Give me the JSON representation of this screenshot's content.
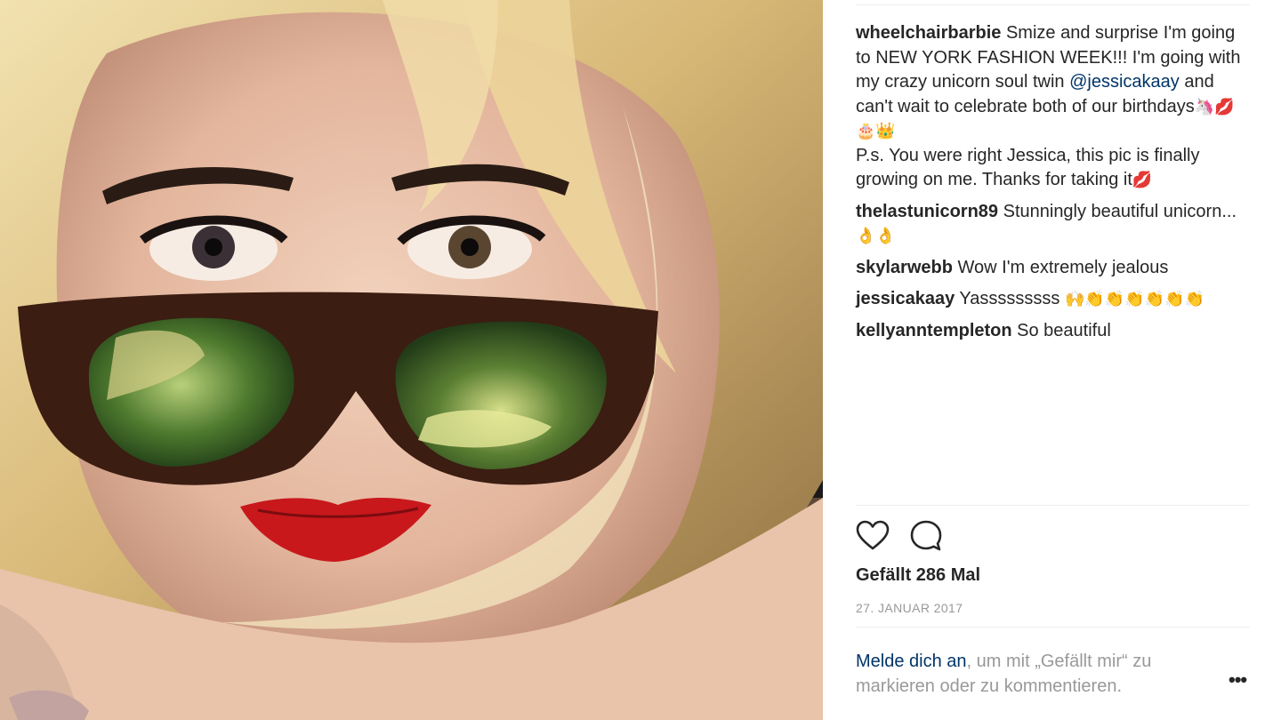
{
  "post": {
    "image_alt": "Photo of a woman with blonde hair, red lipstick and mirrored sunglasses",
    "colors": {
      "username": "#262626",
      "link": "#003569",
      "muted": "#999999"
    }
  },
  "comments": [
    {
      "user": "wheelchairbarbie",
      "line1_pre": " Smize and surprise I'm going to NEW YORK FASHION WEEK!!! I'm going with my crazy unicorn soul twin ",
      "mention": "@jessicakaay",
      "line1_post": " and can't wait to celebrate both of our birthdays",
      "line1_emoji": "🦄💋🎂👑",
      "line2": "P.s. You were right Jessica, this pic is finally growing on me. Thanks for taking it",
      "line2_emoji": "💋"
    },
    {
      "user": "thelastunicorn89",
      "text": " Stunningly beautiful unicorn...",
      "emoji": "👌👌"
    },
    {
      "user": "skylarwebb",
      "text": " Wow I'm extremely jealous",
      "emoji": ""
    },
    {
      "user": "jessicakaay",
      "text": " Yasssssssss ",
      "emoji": "🙌👏👏👏👏👏👏"
    },
    {
      "user": "kellyanntempleton",
      "text": " So beautiful",
      "emoji": ""
    }
  ],
  "actions": {
    "like_icon": "heart-icon",
    "comment_icon": "comment-icon"
  },
  "likes_text": "Gefällt 286 Mal",
  "date_text": "27. JANUAR 2017",
  "login": {
    "link_text": "Melde dich an",
    "rest_text": ", um mit „Gefällt mir“ zu markieren oder zu kommentieren."
  },
  "more_label": "•••"
}
